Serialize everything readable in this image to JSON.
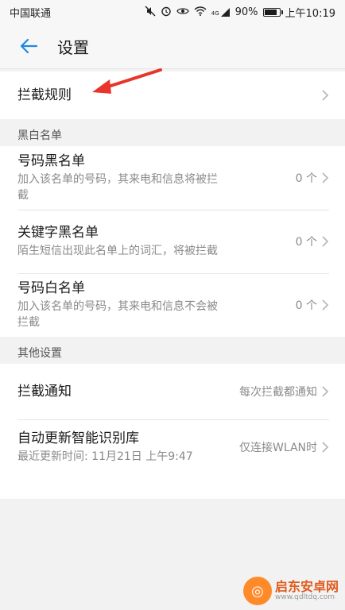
{
  "status": {
    "carrier": "中国联通",
    "signal_label": "4G",
    "battery": "90%",
    "battery_level": 0.9,
    "time": "上午10:19"
  },
  "header": {
    "title": "设置"
  },
  "rule_row": {
    "label": "拦截规则"
  },
  "sections": {
    "blackwhite": "黑白名单",
    "other": "其他设置"
  },
  "lists": [
    {
      "title": "号码黑名单",
      "desc": "加入该名单的号码，其来电和信息将被拦截",
      "count": "0 个"
    },
    {
      "title": "关键字黑名单",
      "desc": "陌生短信出现此名单上的词汇，将被拦截",
      "count": "0 个"
    },
    {
      "title": "号码白名单",
      "desc": "加入该名单的号码，其来电和信息不会被拦截",
      "count": "0 个"
    }
  ],
  "other": {
    "notify": {
      "title": "拦截通知",
      "value": "每次拦截都通知"
    },
    "update": {
      "title": "自动更新智能识别库",
      "desc": "最近更新时间: 11月21日 上午9:47",
      "value": "仅连接WLAN时"
    }
  },
  "watermark": {
    "main": "启东安卓网",
    "sub": "www.qdltdq.com"
  },
  "colors": {
    "accent": "#1e88e5",
    "annotation": "#e8342a"
  }
}
